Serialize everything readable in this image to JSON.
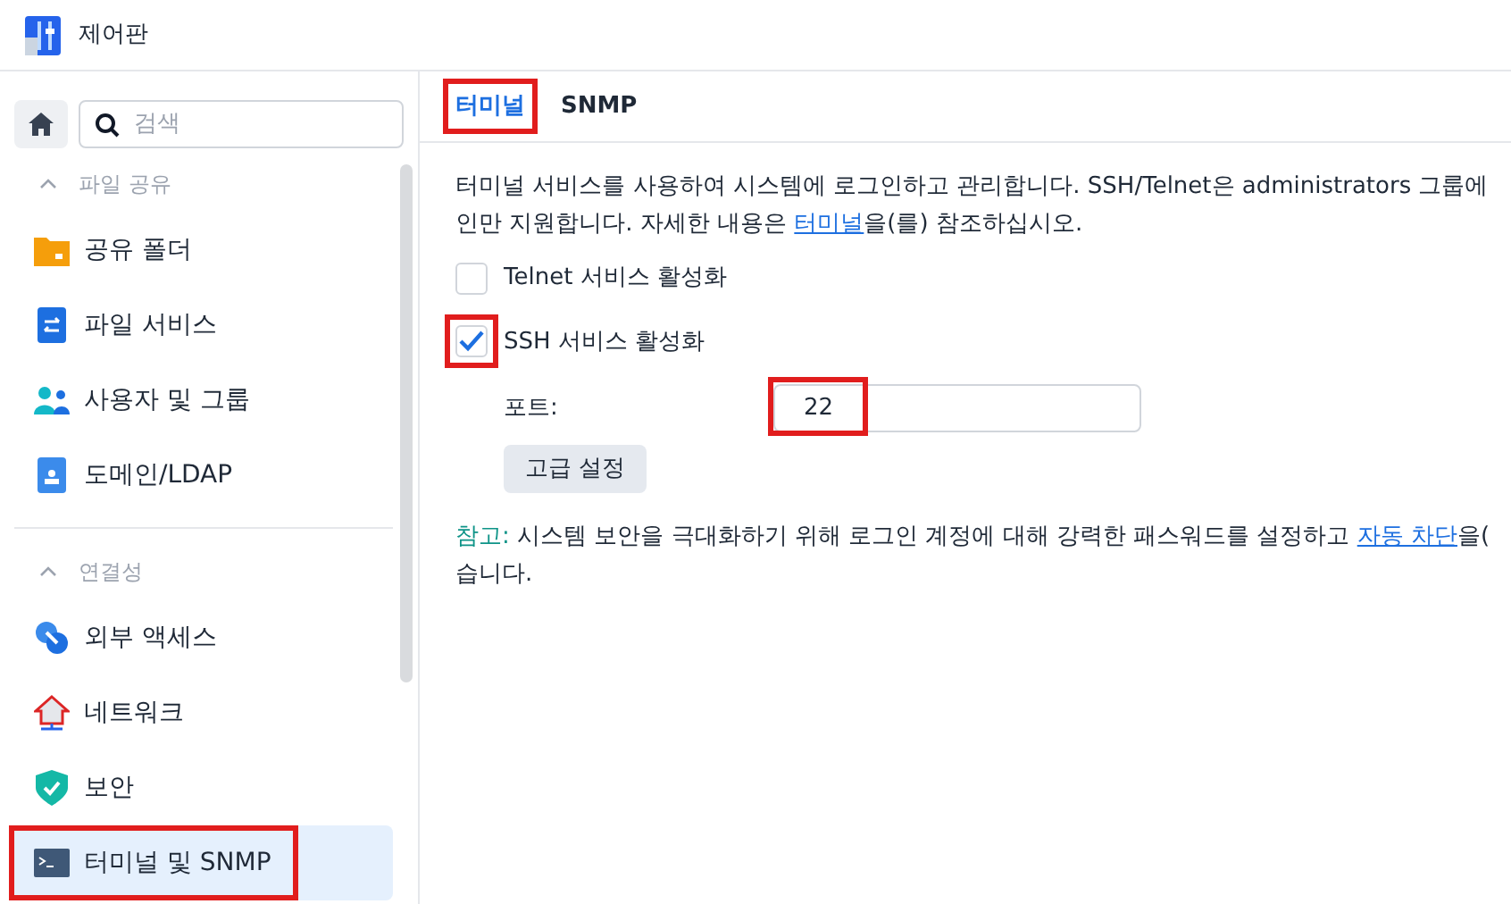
{
  "window": {
    "title": "제어판"
  },
  "sidebar": {
    "search": {
      "placeholder": "검색"
    },
    "sections": [
      {
        "title": "파일 공유",
        "expanded": true,
        "items": [
          {
            "label": "공유 폴더",
            "kind": "folder",
            "selected": false,
            "highlighted": false
          },
          {
            "label": "파일 서비스",
            "kind": "file-service",
            "selected": false,
            "highlighted": false
          },
          {
            "label": "사용자 및 그룹",
            "kind": "users",
            "selected": false,
            "highlighted": false
          },
          {
            "label": "도메인/LDAP",
            "kind": "domain",
            "selected": false,
            "highlighted": false
          }
        ]
      },
      {
        "title": "연결성",
        "expanded": true,
        "items": [
          {
            "label": "외부 액세스",
            "kind": "link",
            "selected": false,
            "highlighted": false
          },
          {
            "label": "네트워크",
            "kind": "house",
            "selected": false,
            "highlighted": false
          },
          {
            "label": "보안",
            "kind": "shield",
            "selected": false,
            "highlighted": false
          },
          {
            "label": "터미널 및 SNMP",
            "kind": "terminal",
            "selected": true,
            "highlighted": true
          }
        ]
      }
    ]
  },
  "tabs": [
    {
      "label": "터미널",
      "selected": true,
      "highlighted": true
    },
    {
      "label": "SNMP",
      "selected": false,
      "highlighted": false
    }
  ],
  "description": [
    [
      {
        "text": "터미널 서비스를 사용하여 시스템에 로그인하고 관리합니다. SSH/Telnet은 administrators 그룹에"
      }
    ],
    [
      {
        "text": "인만 지원합니다. 자세한 내용은 "
      },
      {
        "text": "터미널",
        "kind": "link"
      },
      {
        "text": "을(를) 참조하십시오."
      }
    ]
  ],
  "options": [
    {
      "label": "Telnet 서비스 활성화",
      "checked": false,
      "highlighted": false
    },
    {
      "label": "SSH 서비스 활성화",
      "checked": true,
      "highlighted": true
    }
  ],
  "port": {
    "label": "포트:",
    "value": "22",
    "highlighted": true
  },
  "advanced_button": "고급 설정",
  "note": [
    [
      {
        "text": "참고:",
        "kind": "label"
      },
      {
        "text": " 시스템 보안을 극대화하기 위해 로그인 계정에 대해 강력한 패스워드를 설정하고 "
      },
      {
        "text": "자동 차단",
        "kind": "link"
      },
      {
        "text": "을("
      }
    ],
    [
      {
        "text": "습니다."
      }
    ]
  ]
}
